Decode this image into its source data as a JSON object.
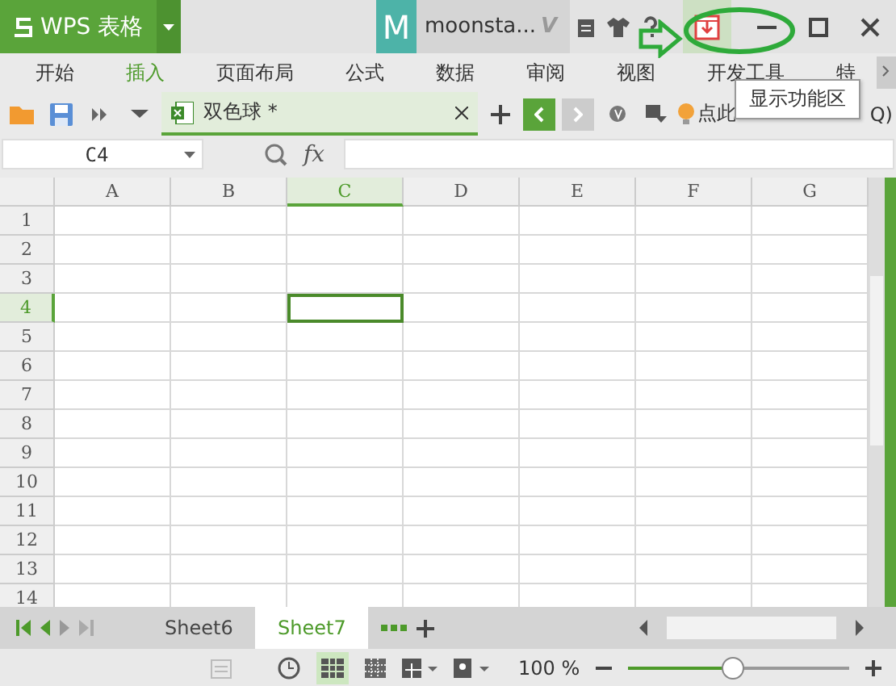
{
  "app": {
    "title": "WPS 表格"
  },
  "account": {
    "avatar": "M",
    "user": "moonsta...",
    "vip": "V"
  },
  "menu_tabs": [
    {
      "label": "开始",
      "selected": false
    },
    {
      "label": "插入",
      "selected": true
    },
    {
      "label": "页面布局",
      "selected": false
    },
    {
      "label": "公式",
      "selected": false
    },
    {
      "label": "数据",
      "selected": false
    },
    {
      "label": "审阅",
      "selected": false
    },
    {
      "label": "视图",
      "selected": false
    },
    {
      "label": "开发工具",
      "selected": false
    },
    {
      "label": "特",
      "selected": false
    }
  ],
  "document_tab": {
    "title": "双色球 *"
  },
  "command_search": {
    "placeholder": "点此",
    "tail": "Q)"
  },
  "formula_bar": {
    "name_box": "C4",
    "fx": "fx"
  },
  "columns": [
    {
      "label": "A",
      "selected": false
    },
    {
      "label": "B",
      "selected": false
    },
    {
      "label": "C",
      "selected": true
    },
    {
      "label": "D",
      "selected": false
    },
    {
      "label": "E",
      "selected": false
    },
    {
      "label": "F",
      "selected": false
    },
    {
      "label": "G",
      "selected": false
    }
  ],
  "rows": [
    {
      "label": "1",
      "selected": false
    },
    {
      "label": "2",
      "selected": false
    },
    {
      "label": "3",
      "selected": false
    },
    {
      "label": "4",
      "selected": true
    },
    {
      "label": "5",
      "selected": false
    },
    {
      "label": "6",
      "selected": false
    },
    {
      "label": "7",
      "selected": false
    },
    {
      "label": "8",
      "selected": false
    },
    {
      "label": "9",
      "selected": false
    },
    {
      "label": "10",
      "selected": false
    },
    {
      "label": "11",
      "selected": false
    },
    {
      "label": "12",
      "selected": false
    },
    {
      "label": "13",
      "selected": false
    },
    {
      "label": "14",
      "selected": false
    }
  ],
  "sheets": [
    {
      "label": "Sheet6",
      "selected": false
    },
    {
      "label": "Sheet7",
      "selected": true
    }
  ],
  "status_bar": {
    "zoom": "100 %",
    "zoom_slider": {
      "level": 0.47
    }
  },
  "tooltip": {
    "text": "显示功能区"
  }
}
